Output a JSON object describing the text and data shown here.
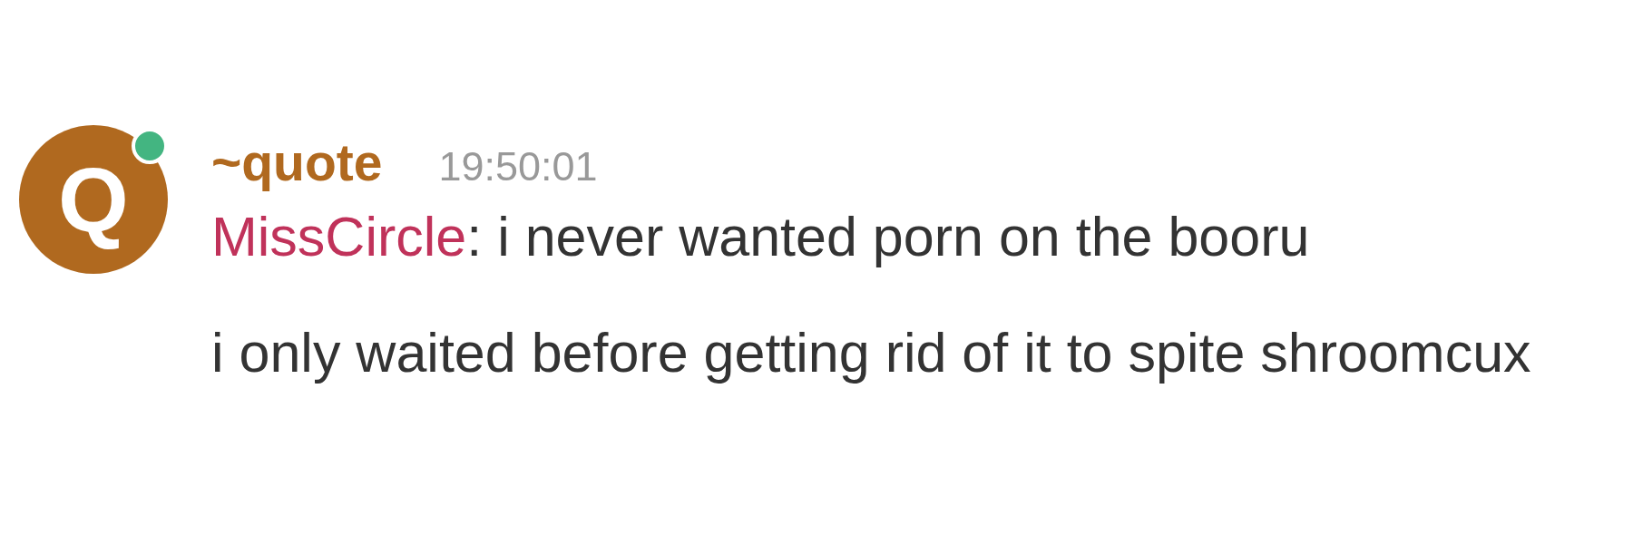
{
  "message": {
    "avatar": {
      "letter": "Q",
      "color": "#b0691f",
      "online": true
    },
    "author": {
      "name": "~quote",
      "color": "#b0691f"
    },
    "timestamp": "19:50:01",
    "paragraphs": [
      {
        "speaker": "MissCircle",
        "color": "#c0325a",
        "text": ": i never wanted porn on the booru"
      },
      {
        "text": "i only waited before getting rid of it to spite shroomcux"
      }
    ]
  }
}
